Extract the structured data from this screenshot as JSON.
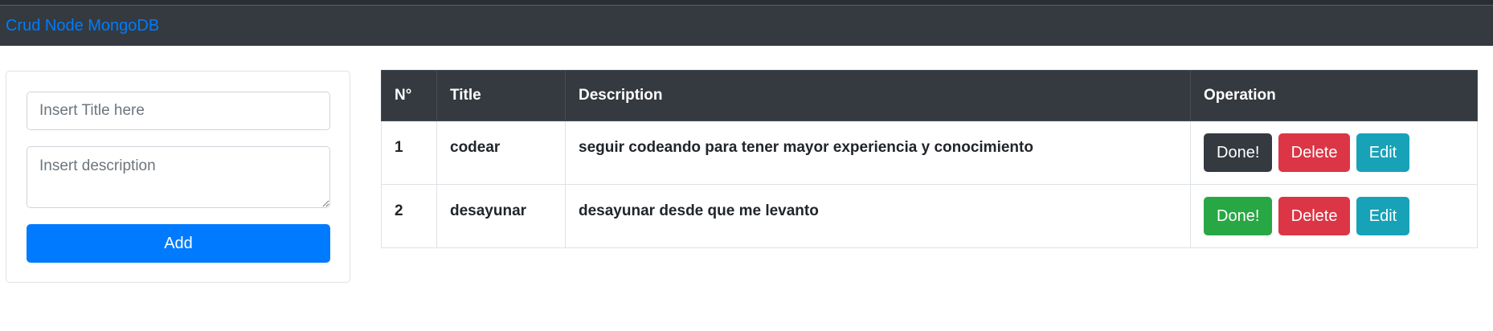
{
  "navbar": {
    "brand": "Crud Node MongoDB"
  },
  "form": {
    "title_placeholder": "Insert Title here",
    "title_value": "",
    "description_placeholder": "Insert description",
    "description_value": "",
    "add_label": "Add"
  },
  "table": {
    "headers": [
      "N°",
      "Title",
      "Description",
      "Operation"
    ],
    "rows": [
      {
        "number": "1",
        "title": "codear",
        "description": "seguir codeando para tener mayor experiencia y conocimiento",
        "done_label": "Done!",
        "done_state": "dark",
        "delete_label": "Delete",
        "edit_label": "Edit"
      },
      {
        "number": "2",
        "title": "desayunar",
        "description": "desayunar desde que me levanto",
        "done_label": "Done!",
        "done_state": "success",
        "delete_label": "Delete",
        "edit_label": "Edit"
      }
    ]
  },
  "colors": {
    "navbar_bg": "#343a40",
    "brand": "#007bff",
    "primary": "#007bff",
    "dark": "#343a40",
    "success": "#28a745",
    "danger": "#dc3545",
    "info": "#17a2b8"
  }
}
